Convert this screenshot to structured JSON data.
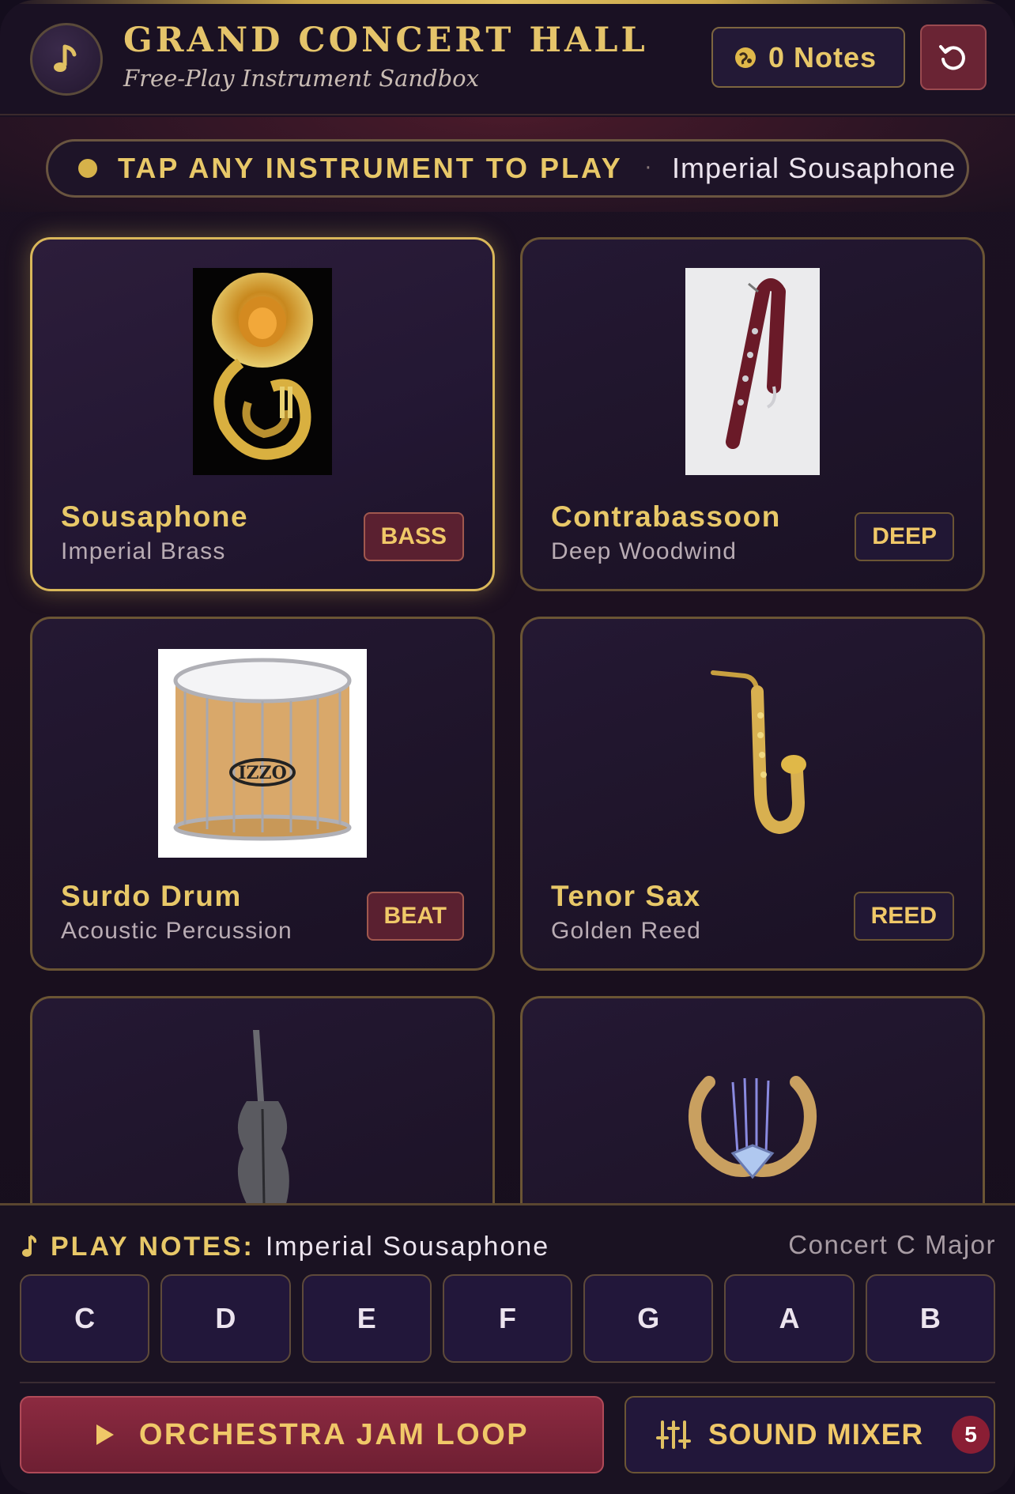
{
  "header": {
    "title": "GRAND CONCERT HALL",
    "subtitle": "Free-Play Instrument Sandbox",
    "notes_count": "0 Notes"
  },
  "banner": {
    "label": "TAP ANY INSTRUMENT TO PLAY",
    "separator": "·",
    "selected": "Imperial Sousaphone"
  },
  "instruments": [
    {
      "name": "Sousaphone",
      "family": "Imperial Brass",
      "tag": "BASS",
      "selected": true
    },
    {
      "name": "Contrabassoon",
      "family": "Deep Woodwind",
      "tag": "DEEP",
      "selected": false
    },
    {
      "name": "Surdo Drum",
      "family": "Acoustic Percussion",
      "tag": "BEAT",
      "selected": false
    },
    {
      "name": "Tenor Sax",
      "family": "Golden Reed",
      "tag": "REED",
      "selected": false
    },
    {
      "name": "",
      "family": "",
      "tag": "",
      "selected": false
    },
    {
      "name": "",
      "family": "",
      "tag": "",
      "selected": false
    }
  ],
  "play_notes": {
    "label": "PLAY NOTES:",
    "instrument": "Imperial Sousaphone",
    "key": "Concert C Major",
    "keys": [
      "C",
      "D",
      "E",
      "F",
      "G",
      "A",
      "B"
    ]
  },
  "actions": {
    "jam_loop": "ORCHESTRA JAM LOOP",
    "mixer": "SOUND MIXER",
    "mixer_badge": "5"
  },
  "colors": {
    "accent_gold": "#e8c868",
    "card_border": "#6b5534",
    "selected_border": "#d9b75a",
    "jam_red": "#8c2a40"
  }
}
